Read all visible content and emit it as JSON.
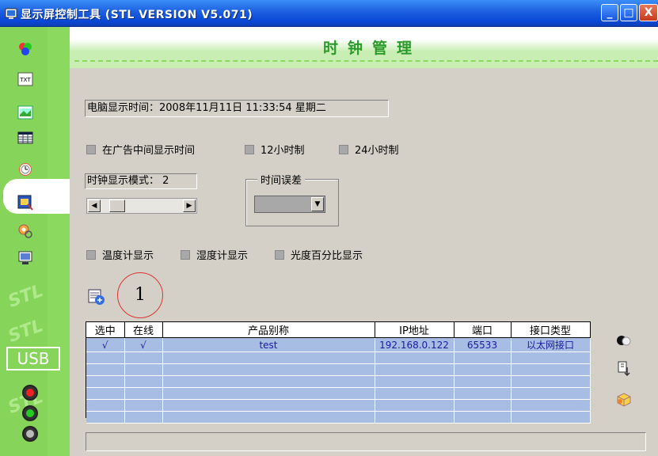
{
  "window": {
    "title": "显示屏控制工具 (STL VERSION V5.071)",
    "minimize_glyph": "_",
    "maximize_glyph": "□",
    "close_glyph": "X"
  },
  "sidebar": {
    "items": [
      {
        "name": "color-icon"
      },
      {
        "name": "text-icon",
        "label": "TXT"
      },
      {
        "name": "picture-icon"
      },
      {
        "name": "table-icon"
      },
      {
        "name": "clock-icon"
      },
      {
        "name": "effects-icon"
      },
      {
        "name": "gear-search-icon"
      },
      {
        "name": "monitor-icon"
      }
    ],
    "watermark": "STL",
    "usb_label": "USB"
  },
  "page": {
    "title": "时钟管理"
  },
  "clock": {
    "pc_time_label": "电脑显示时间：2008年11月11日 11:33:54  星期二",
    "show_in_ad_label": "在广告中间显示时间",
    "hour12_label": "12小时制",
    "hour24_label": "24小时制",
    "display_mode_label": "时钟显示模式：  2",
    "time_error_label": "时间误差",
    "thermometer_label": "温度计显示",
    "hygrometer_label": "湿度计显示",
    "light_percent_label": "光度百分比显示",
    "callout_number": "1"
  },
  "device_table": {
    "columns": [
      "选中",
      "在线",
      "产品别称",
      "IP地址",
      "端口",
      "接口类型"
    ],
    "rows": [
      [
        "√",
        "√",
        "test",
        "192.168.0.122",
        "65533",
        "以太网接口"
      ]
    ],
    "empty_rows": 6
  },
  "colors": {
    "accent_green": "#8bd95f",
    "title_green": "#2a9a2a",
    "table_row": "#a7bde3",
    "callout_red": "#dd3333"
  }
}
